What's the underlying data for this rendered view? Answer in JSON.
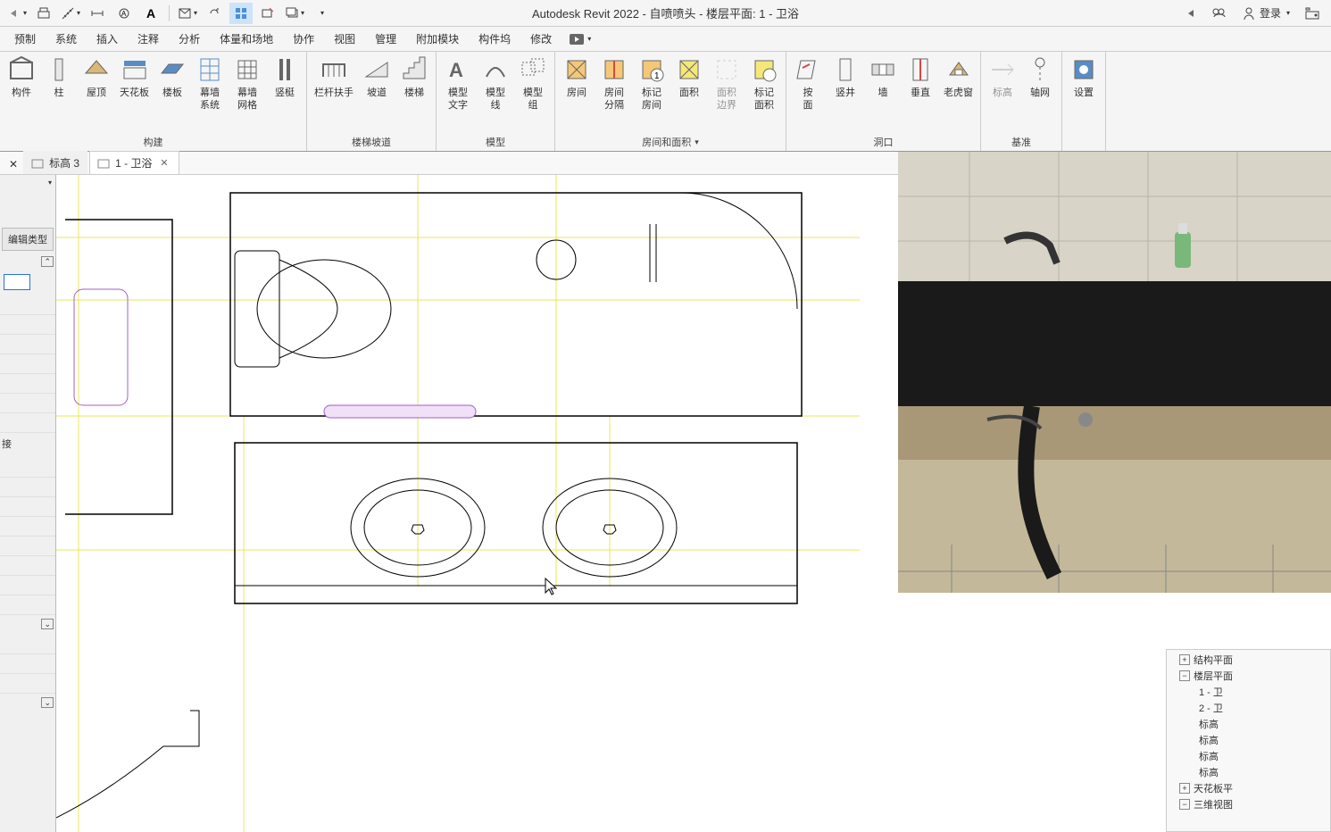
{
  "title": "Autodesk Revit 2022 - 自喷喷头 - 楼层平面: 1 - 卫浴",
  "login_label": "登录",
  "ribbon_tabs": [
    "预制",
    "系统",
    "插入",
    "注释",
    "分析",
    "体量和场地",
    "协作",
    "视图",
    "管理",
    "附加模块",
    "构件坞",
    "修改"
  ],
  "ribbon": {
    "groups": [
      {
        "title": "构建",
        "items": [
          {
            "label": "构件",
            "icon": "component"
          },
          {
            "label": "柱",
            "icon": "column"
          },
          {
            "label": "屋顶",
            "icon": "roof"
          },
          {
            "label": "天花板",
            "icon": "ceiling"
          },
          {
            "label": "楼板",
            "icon": "floor"
          },
          {
            "label": "幕墙\n系统",
            "icon": "curtain-system"
          },
          {
            "label": "幕墙\n网格",
            "icon": "curtain-grid"
          },
          {
            "label": "竖梃",
            "icon": "mullion"
          }
        ]
      },
      {
        "title": "楼梯坡道",
        "items": [
          {
            "label": "栏杆扶手",
            "icon": "railing"
          },
          {
            "label": "坡道",
            "icon": "ramp"
          },
          {
            "label": "楼梯",
            "icon": "stair"
          }
        ]
      },
      {
        "title": "模型",
        "items": [
          {
            "label": "模型\n文字",
            "icon": "model-text"
          },
          {
            "label": "模型\n线",
            "icon": "model-line"
          },
          {
            "label": "模型\n组",
            "icon": "model-group"
          }
        ]
      },
      {
        "title": "房间和面积",
        "arrow": true,
        "items": [
          {
            "label": "房间",
            "icon": "room"
          },
          {
            "label": "房间\n分隔",
            "icon": "room-sep"
          },
          {
            "label": "标记\n房间",
            "icon": "room-tag"
          },
          {
            "label": "面积",
            "icon": "area"
          },
          {
            "label": "面积\n边界",
            "icon": "area-bound",
            "disabled": true
          },
          {
            "label": "标记\n面积",
            "icon": "area-tag"
          }
        ]
      },
      {
        "title": "洞口",
        "items": [
          {
            "label": "按\n面",
            "icon": "byface"
          },
          {
            "label": "竖井",
            "icon": "shaft"
          },
          {
            "label": "墙",
            "icon": "wall-open"
          },
          {
            "label": "垂直",
            "icon": "vertical"
          },
          {
            "label": "老虎窗",
            "icon": "dormer"
          }
        ]
      },
      {
        "title": "基准",
        "items": [
          {
            "label": "标高",
            "icon": "level",
            "disabled": true
          },
          {
            "label": "轴网",
            "icon": "grid"
          }
        ]
      },
      {
        "title": "",
        "items": [
          {
            "label": "设置",
            "icon": "settings"
          }
        ]
      }
    ]
  },
  "view_tabs": [
    {
      "label": "标高 3",
      "active": false
    },
    {
      "label": "1 - 卫浴",
      "active": true
    }
  ],
  "props": {
    "edit_type": "编辑类型",
    "connect": "接"
  },
  "browser": {
    "items": [
      {
        "exp": "+",
        "label": "结构平面",
        "indent": 1
      },
      {
        "exp": "-",
        "label": "楼层平面",
        "indent": 1
      },
      {
        "label": "1 - 卫",
        "indent": 2
      },
      {
        "label": "2 - 卫",
        "indent": 2
      },
      {
        "label": "标高",
        "indent": 2
      },
      {
        "label": "标高",
        "indent": 2
      },
      {
        "label": "标高",
        "indent": 2
      },
      {
        "label": "标高",
        "indent": 2
      },
      {
        "exp": "+",
        "label": "天花板平",
        "indent": 1
      },
      {
        "exp": "-",
        "label": "三维视图",
        "indent": 1
      }
    ]
  }
}
